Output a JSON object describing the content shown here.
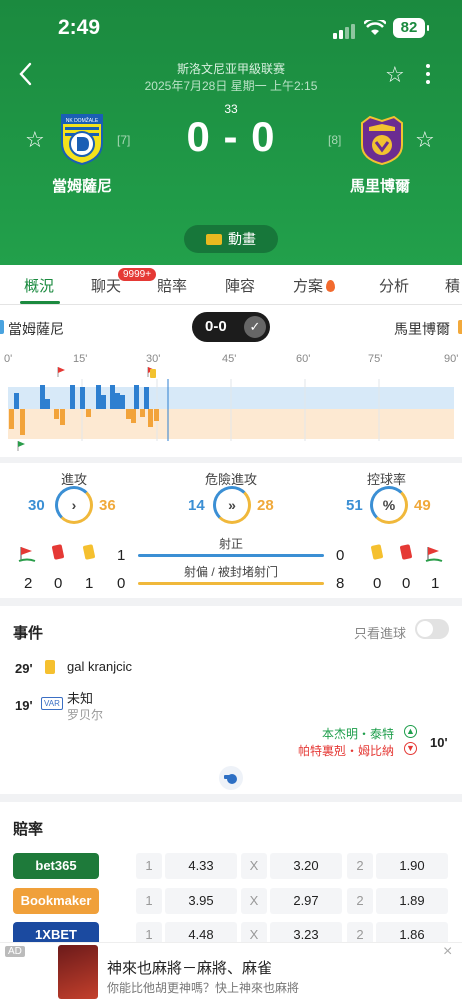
{
  "status": {
    "time": "2:49",
    "battery": "82"
  },
  "header": {
    "league": "斯洛文尼亚甲級联赛",
    "date": "2025年7月28日 星期一 上午2:15",
    "minute": "33",
    "score": "0 - 0",
    "home": {
      "name": "當姆薩尼",
      "rank": "[7]",
      "logo_text": "NK DOMŽALE"
    },
    "away": {
      "name": "馬里博爾",
      "rank": "[8]"
    },
    "animation_label": "動畫"
  },
  "tabs": [
    {
      "label": "概況"
    },
    {
      "label": "聊天"
    },
    {
      "label": "賠率"
    },
    {
      "label": "陣容"
    },
    {
      "label": "方案"
    },
    {
      "label": "分析"
    },
    {
      "label": "積"
    }
  ],
  "chat_badge": "9999+",
  "scorebar": {
    "home": "當姆薩尼",
    "away": "馬里博爾",
    "score": "0-0"
  },
  "timeline": {
    "ticks": [
      "0'",
      "15'",
      "30'",
      "45'",
      "60'",
      "75'",
      "90'"
    ],
    "current_minute": 33
  },
  "stats": {
    "attack": {
      "label": "進攻",
      "home": "30",
      "away": "36",
      "icon": "chevron-right-icon"
    },
    "danger": {
      "label": "危險進攻",
      "home": "14",
      "away": "28",
      "icon": "double-chevron-icon"
    },
    "possession": {
      "label": "控球率",
      "home": "51",
      "away": "49",
      "icon": "percent-icon"
    },
    "home_corners": "2",
    "home_red": "0",
    "home_yellow": "1",
    "home_shots_on": "1",
    "home_shots_off": "0",
    "away_shots_on": "0",
    "away_shots_off": "8",
    "away_yellow": "0",
    "away_red": "0",
    "away_corners": "1",
    "shots_on_label": "射正",
    "shots_off_label": "射偏 / 被封堵射门"
  },
  "events": {
    "title": "事件",
    "only_goals_label": "只看進球",
    "items": [
      {
        "minute": "29'",
        "text": "gal kranjcic"
      },
      {
        "minute": "19'",
        "var": "VAR",
        "text": "未知",
        "sub": "罗贝尔"
      },
      {
        "minute": "10'",
        "in": "本杰明・泰特",
        "out": "帕特裏剋・姆比納"
      }
    ]
  },
  "odds": {
    "title": "賠率",
    "rows": [
      {
        "book": "bet365",
        "color": "#1e7a3a",
        "c1": "1",
        "v1": "4.33",
        "cx": "X",
        "vx": "3.20",
        "c2": "2",
        "v2": "1.90"
      },
      {
        "book": "Bookmaker",
        "color": "#f0a03a",
        "c1": "1",
        "v1": "3.95",
        "cx": "X",
        "vx": "2.97",
        "c2": "2",
        "v2": "1.89"
      },
      {
        "book": "1XBET",
        "color": "#1b4aa0",
        "c1": "1",
        "v1": "4.48",
        "cx": "X",
        "vx": "3.23",
        "c2": "2",
        "v2": "1.86"
      }
    ]
  },
  "ad": {
    "tag": "AD",
    "title": "神來也麻將－麻將、麻雀",
    "subtitle": "你能比他胡更神嗎？快上神來也麻將",
    "close": "×"
  }
}
